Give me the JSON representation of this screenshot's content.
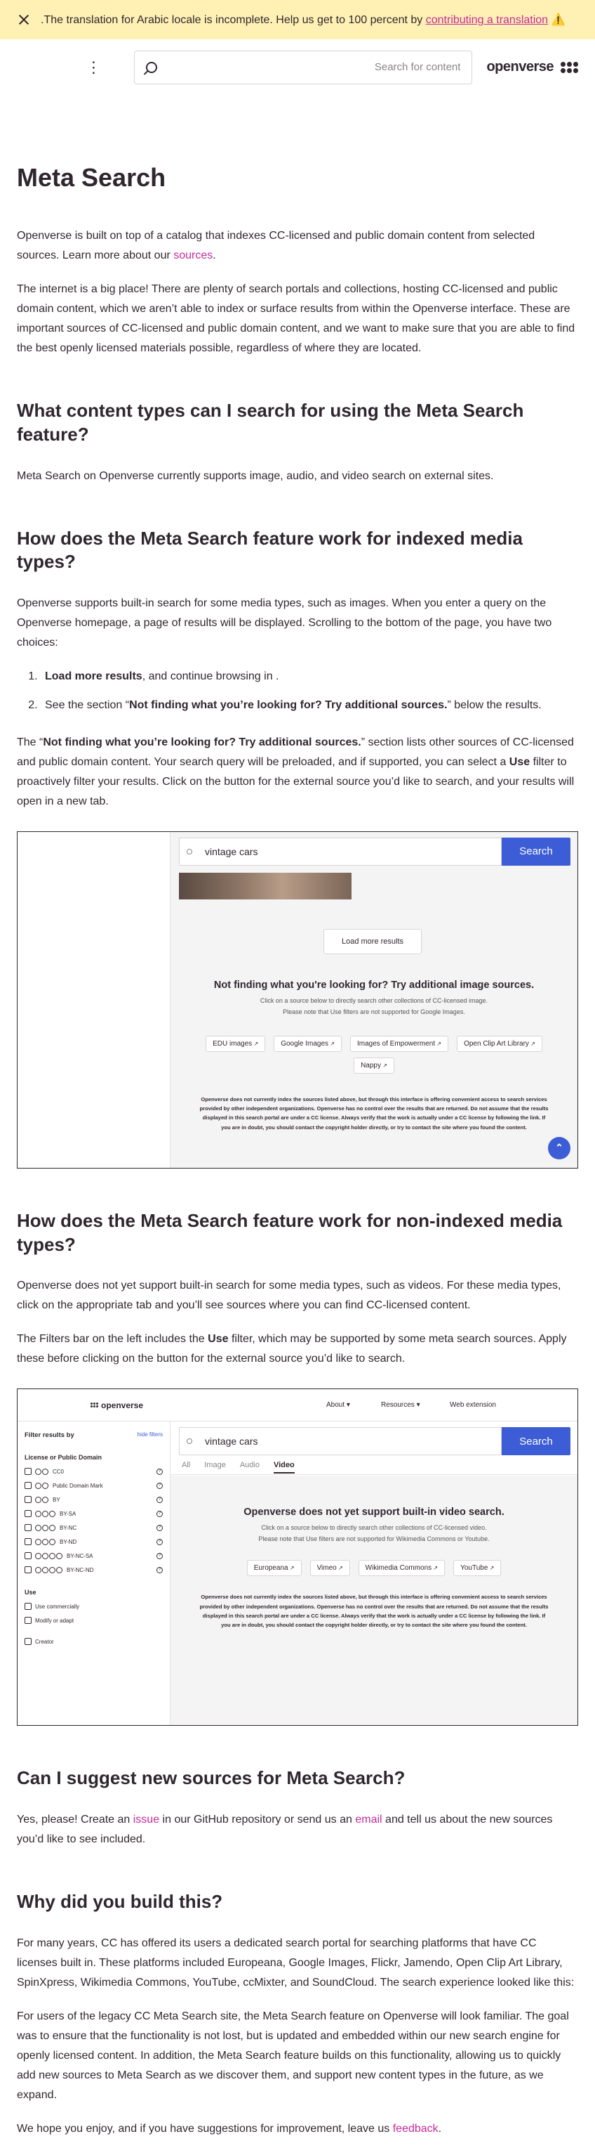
{
  "banner": {
    "text": ".The translation for Arabic locale is incomplete. Help us get to 100 percent by ",
    "link": "contributing a translation",
    "warning": "⚠️"
  },
  "header": {
    "menu_icon": "⋮",
    "search_placeholder": "Search for content",
    "brand": "openverse"
  },
  "page": {
    "title": "Meta Search",
    "intro_1_a": "Openverse is built on top of a catalog that indexes CC-licensed and public domain content from selected sources. Learn more about our ",
    "intro_1_link": "sources",
    "intro_1_b": ".",
    "intro_2": "The internet is a big place! There are plenty of search portals and collections, hosting CC-licensed and public domain content, which we aren’t able to index or surface results from within the Openverse interface. These are important sources of CC-licensed and public domain content, and we want to make sure that you are able to find the best openly licensed materials possible, regardless of where they are located.",
    "h_types": "What content types can I search for using the Meta Search feature?",
    "p_types": "Meta Search on Openverse currently supports image, audio, and video search on external sites.",
    "h_indexed": "How does the Meta Search feature work for indexed media types?",
    "p_indexed": "Openverse supports built-in search for some media types, such as images. When you enter a query on the Openverse homepage, a page of results will be displayed. Scrolling to the bottom of the page, you have two choices:",
    "li1_strong": "Load more results",
    "li1_rest": ", and continue browsing in .",
    "li2_pre": "See the section “",
    "li2_strong": "Not finding what you’re looking for? Try additional sources.",
    "li2_post": "” below the results.",
    "p_section_pre": "The “",
    "p_section_strong": "Not finding what you’re looking for? Try additional sources.",
    "p_section_mid": "” section lists other sources of CC-licensed and public domain content. Your search query will be preloaded, and if supported, you can select a ",
    "p_section_use": "Use",
    "p_section_post": " filter to proactively filter your results. Click on the button for the external source you’d like to search, and your results will open in a new tab.",
    "h_nonindexed": "How does the Meta Search feature work for non-indexed media types?",
    "p_nonindexed": "Openverse does not yet support built-in search for some media types, such as videos. For these media types, click on the appropriate tab and you’ll see sources where you can find CC-licensed content.",
    "p_filters_pre": "The Filters bar on the left includes the ",
    "p_filters_use": "Use",
    "p_filters_post": " filter, which may be supported by some meta search sources. Apply these before clicking on the button for the external source you’d like to search.",
    "h_suggest": "Can I suggest new sources for Meta Search?",
    "p_suggest_a": "Yes, please! Create an ",
    "p_suggest_issue": "issue",
    "p_suggest_b": " in our GitHub repository or send us an ",
    "p_suggest_email": "email",
    "p_suggest_c": " and tell us about the new sources you’d like to see included.",
    "h_why": "Why did you build this?",
    "p_why_1": "For many years, CC has offered its users a dedicated search portal for searching platforms that have CC licenses built in. These platforms included Europeana, Google Images, Flickr, Jamendo, Open Clip Art Library, SpinXpress, Wikimedia Commons, YouTube, ccMixter, and SoundCloud. The search experience looked like this:",
    "p_why_2": "For users of the legacy CC Meta Search site, the Meta Search feature on Openverse will look familiar. The goal was to ensure that the functionality is not lost, but is updated and embedded within our new search engine for openly licensed content. In addition, the Meta Search feature builds on this functionality, allowing us to quickly add new sources to Meta Search as we discover them, and support new content types in the future, as we expand.",
    "p_end_a": "We hope you enjoy, and if you have suggestions for improvement, leave us ",
    "p_end_link": "feedback",
    "p_end_b": "."
  },
  "shot1": {
    "query": "vintage cars",
    "search_btn": "Search",
    "load_more": "Load more results",
    "title": "Not finding what you're looking for? Try additional image sources.",
    "sub_1": "Click on a source below to directly search other collections of CC-licensed image.",
    "sub_2": "Please note that Use filters are not supported for Google Images.",
    "sources": [
      "EDU images",
      "Google Images",
      "Images of Empowerment",
      "Open Clip Art Library",
      "Nappy"
    ],
    "disclaimer": "Openverse does not currently index the sources listed above, but through this interface is offering convenient access to search services provided by other independent organizations. Openverse has no control over the results that are returned. Do not assume that the results displayed in this search portal are under a CC license. Always verify that the work is actually under a CC license by following the link. If you are in doubt, you should contact the copyright holder directly, or try to contact the site where you found the content.",
    "top_icon": "⌃"
  },
  "shot2": {
    "brand": "openverse",
    "nav": [
      "About ▾",
      "Resources ▾",
      "Web extension"
    ],
    "filter_heading": "Filter results by",
    "hide_filters": "hide filters",
    "license_heading": "License or Public Domain",
    "licenses": [
      "CC0",
      "Public Domain Mark",
      "BY",
      "BY-SA",
      "BY-NC",
      "BY-ND",
      "BY-NC-SA",
      "BY-NC-ND"
    ],
    "use_heading": "Use",
    "uses": [
      "Use commercially",
      "Modify or adapt"
    ],
    "creator": "Creator",
    "query": "vintage cars",
    "search_btn": "Search",
    "tabs": [
      "All",
      "Image",
      "Audio",
      "Video"
    ],
    "title": "Openverse does not yet support built-in video search.",
    "sub_1": "Click on a source below to directly search other collections of CC-licensed video.",
    "sub_2": "Please note that Use filters are not supported for Wikimedia Commons or Youtube.",
    "sources": [
      "Europeana",
      "Vimeo",
      "Wikimedia Commons",
      "YouTube"
    ],
    "disclaimer": "Openverse does not currently index the sources listed above, but through this interface is offering convenient access to search services provided by other independent organizations. Openverse has no control over the results that are returned. Do not assume that the results displayed in this search portal are under a CC license. Always verify that the work is actually under a CC license by following the link. If you are in doubt, you should contact the copyright holder directly, or try to contact the site where you found the content."
  }
}
